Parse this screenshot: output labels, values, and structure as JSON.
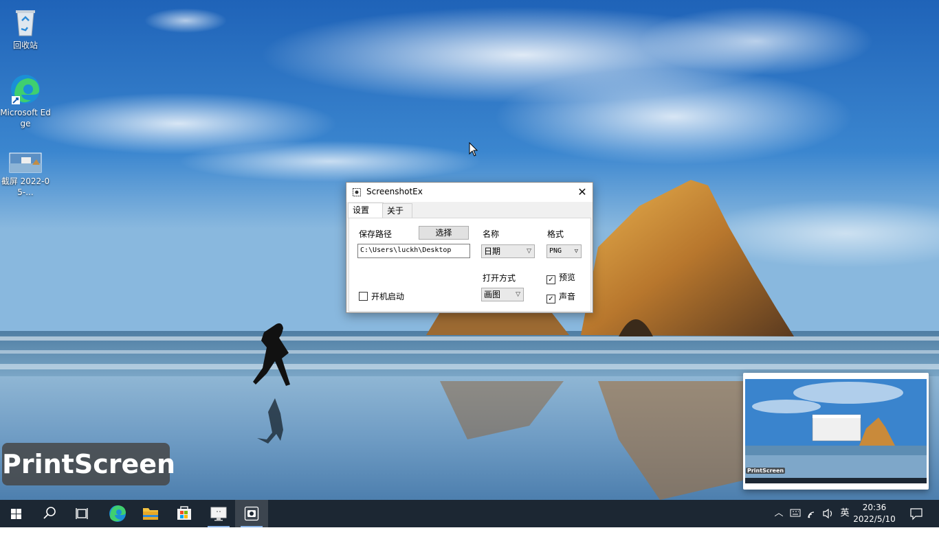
{
  "desktop": {
    "icons": [
      {
        "name": "recycle-bin",
        "label": "回收站"
      },
      {
        "name": "edge",
        "label": "Microsoft Edge"
      },
      {
        "name": "screenshot-file",
        "label": "截屏 2022-05-..."
      }
    ]
  },
  "dialog": {
    "title": "ScreenshotEx",
    "tabs": [
      {
        "label": "设置",
        "active": true
      },
      {
        "label": "关于",
        "active": false
      }
    ],
    "settings": {
      "save_path_label": "保存路径",
      "choose_button": "选择",
      "save_path_value": "C:\\Users\\luckh\\Desktop",
      "name_label": "名称",
      "name_value": "日期",
      "format_label": "格式",
      "format_value": "PNG",
      "open_with_label": "打开方式",
      "open_with_value": "画图",
      "autostart_label": "开机启动",
      "autostart_checked": false,
      "preview_label": "预览",
      "preview_checked": true,
      "sound_label": "声音",
      "sound_checked": true
    }
  },
  "overlay": {
    "badge_text": "PrintScreen",
    "preview_badge_text": "PrintScreen"
  },
  "taskbar": {
    "items": [
      "start-icon",
      "search-icon",
      "task-view-icon",
      "edge-icon",
      "file-explorer-icon",
      "store-icon",
      "display-app-icon",
      "screenshotex-icon"
    ],
    "tray": {
      "ime_text": "英",
      "time": "20:36",
      "date": "2022/5/10"
    }
  },
  "colors": {
    "taskbar": "#1c2733",
    "accent": "#0078d7"
  }
}
